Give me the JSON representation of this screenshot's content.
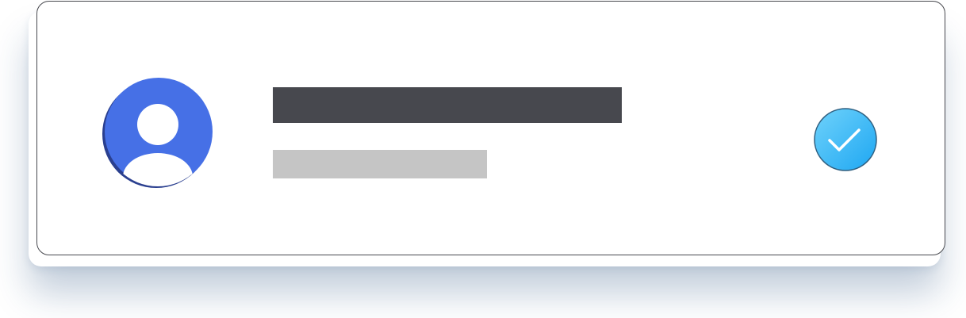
{
  "card": {
    "avatar_icon": "user-avatar-icon",
    "name_placeholder": "",
    "subtitle_placeholder": "",
    "status_icon": "checkmark-icon",
    "status_selected": true
  },
  "colors": {
    "avatar_fill": "#4670e6",
    "avatar_dark": "#2a3f8f",
    "name_bar": "#47484e",
    "subtitle_bar": "#c5c5c5",
    "check_gradient_start": "#6fd2fb",
    "check_gradient_end": "#1ea7f2",
    "card_border": "#47484e"
  }
}
